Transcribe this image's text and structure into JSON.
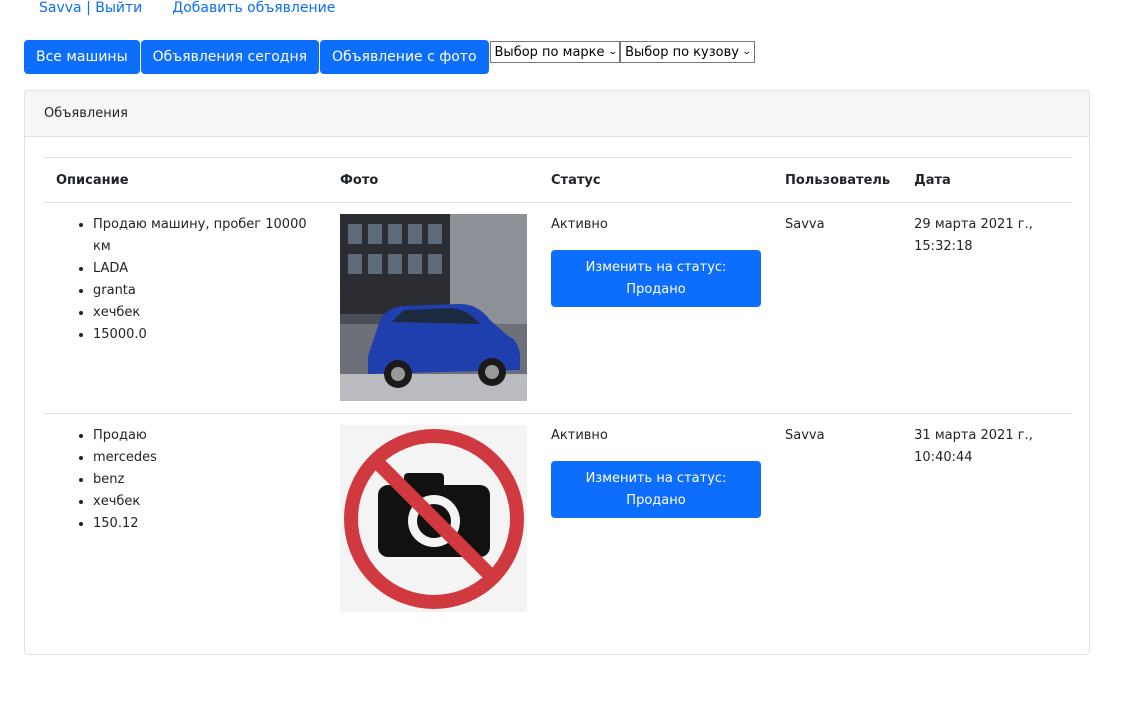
{
  "topnav": {
    "user_logout": "Savva | Выйти",
    "add_ad": "Добавить объявление"
  },
  "toolbar": {
    "all_cars": "Все машины",
    "today_ads": "Объявления сегодня",
    "photo_ads": "Объявление с фото",
    "brand_select": "Выбор по марке",
    "body_select": "Выбор по кузову"
  },
  "card": {
    "header": "Объявления"
  },
  "table": {
    "headers": {
      "description": "Описание",
      "photo": "Фото",
      "status": "Статус",
      "user": "Пользователь",
      "date": "Дата"
    },
    "rows": [
      {
        "description": [
          "Продаю машину, пробег 10000 км",
          "LADA",
          "granta",
          "хечбек",
          "15000.0"
        ],
        "photo_icon": "car-photo",
        "status": "Активно",
        "status_button": "Изменить на статус: Продано",
        "user": "Savva",
        "date": "29 марта 2021 г., 15:32:18"
      },
      {
        "description": [
          "Продаю",
          "mercedes",
          "benz",
          "хечбек",
          "150.12"
        ],
        "photo_icon": "no-photo-icon",
        "status": "Активно",
        "status_button": "Изменить на статус: Продано",
        "user": "Savva",
        "date": "31 марта 2021 г., 10:40:44"
      }
    ]
  }
}
